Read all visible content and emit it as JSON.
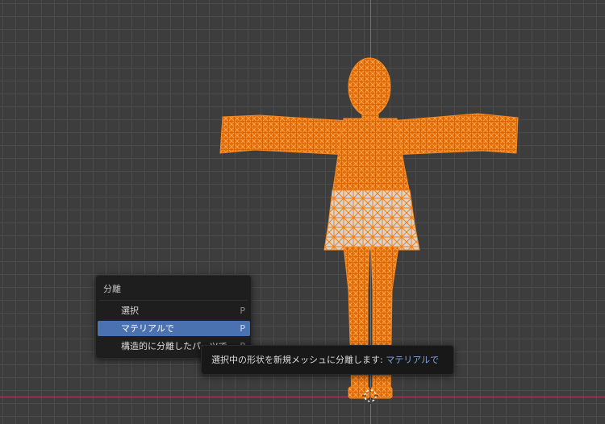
{
  "menu": {
    "title": "分離",
    "items": [
      {
        "label": "選択",
        "shortcut": "P",
        "active": false
      },
      {
        "label": "マテリアルで",
        "shortcut": "P",
        "active": true
      },
      {
        "label": "構造的に分離したパーツで",
        "shortcut": "P",
        "active": false
      }
    ]
  },
  "tooltip": {
    "text": "選択中の形状を新規メッシュに分離します:",
    "highlight": "マテリアルで"
  },
  "colors": {
    "viewport_bg": "#3d3d3d",
    "grid_line": "#4b4b4b",
    "axis_x": "#b0425a",
    "axis_y": "#4a74c9",
    "selection_orange": "#f07f14",
    "menu_bg": "#1e1e1e",
    "menu_active": "#4a72b0",
    "tooltip_highlight": "#7fa4de"
  },
  "icons": [
    "3d-cursor-icon"
  ]
}
